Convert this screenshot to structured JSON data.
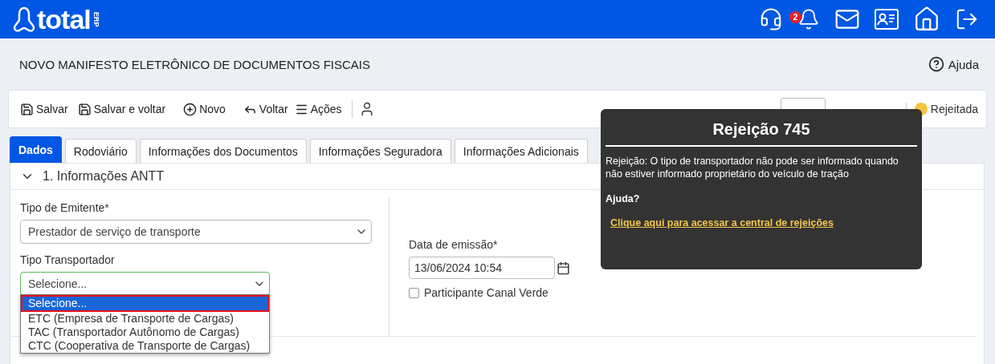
{
  "header": {
    "logo_text": "total",
    "logo_sub": "ERP",
    "notification_count": "2"
  },
  "page": {
    "title": "NOVO MANIFESTO ELETRÔNICO DE DOCUMENTOS FISCAIS",
    "help": "Ajuda"
  },
  "toolbar": {
    "buttons": [
      "Salvar",
      "Salvar e voltar",
      "Novo",
      "Voltar",
      "Ações"
    ],
    "status": {
      "label": "Rejeitada",
      "color": "#f4c542"
    }
  },
  "tabs": [
    {
      "label": "Dados",
      "selected": true
    },
    {
      "label": "Rodoviário",
      "selected": false
    },
    {
      "label": "Informações dos Documentos",
      "selected": false
    },
    {
      "label": "Informações Seguradora",
      "selected": false
    },
    {
      "label": "Informações Adicionais",
      "selected": false
    }
  ],
  "section": {
    "title": "1. Informações ANTT",
    "expanded": true
  },
  "form": {
    "tipo_emitente": {
      "label": "Tipo de Emitente*",
      "value": "Prestador de serviço de transporte"
    },
    "tipo_transportador": {
      "label": "Tipo Transportador",
      "value": "Selecione...",
      "expanded": true,
      "options": [
        {
          "label": "Selecione...",
          "selected": true
        },
        {
          "label": "ETC (Empresa de Transporte de Cargas)",
          "selected": false
        },
        {
          "label": "TAC (Transportador Autônomo de Cargas)",
          "selected": false
        },
        {
          "label": "CTC (Cooperativa de Transporte de Cargas)",
          "selected": false
        }
      ]
    },
    "data_emissao": {
      "label": "Data de emissão*",
      "value": "13/06/2024 10:54"
    },
    "canal_verde": {
      "label": "Participante Canal Verde",
      "checked": false
    }
  },
  "tooltip": {
    "title": "Rejeição 745",
    "message": "Rejeição: O tipo de transportador não pode ser informado quando não estiver informado proprietário do veículo de tração",
    "help_label": "Ajuda?",
    "link": "Clique aqui para acessar a central de rejeições"
  }
}
